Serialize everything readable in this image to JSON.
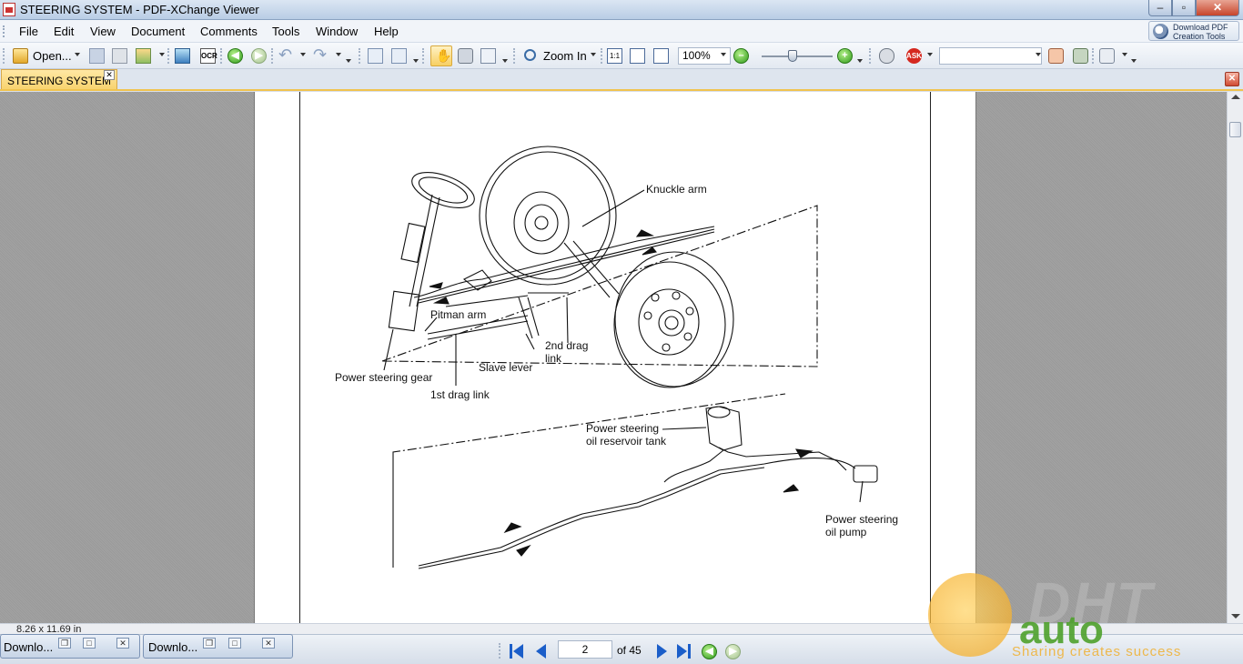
{
  "window": {
    "title": "STEERING SYSTEM - PDF-XChange Viewer",
    "buttons": {
      "minimize": "–",
      "maximize": "▫",
      "close": "✕"
    }
  },
  "menu": {
    "items": [
      "File",
      "Edit",
      "View",
      "Document",
      "Comments",
      "Tools",
      "Window",
      "Help"
    ],
    "download_pdf": {
      "line1": "Download PDF",
      "line2": "Creation Tools"
    }
  },
  "toolbar": {
    "open_label": "Open...",
    "zoom_in_label": "Zoom In",
    "zoom_value": "100%",
    "search_value": ""
  },
  "tab": {
    "label": "STEERING SYSTEM",
    "close": "✕"
  },
  "diagram": {
    "labels": {
      "knuckle_arm": "Knuckle arm",
      "pitman_arm": "Pitman arm",
      "second_drag_link_1": "2nd drag",
      "second_drag_link_2": "link",
      "slave_lever": "Slave lever",
      "power_steering_gear": "Power steering gear",
      "first_drag_link": "1st drag link",
      "reservoir_1": "Power steering",
      "reservoir_2": "oil reservoir tank",
      "pump_1": "Power steering",
      "pump_2": "oil pump"
    }
  },
  "status": {
    "page_size": "8.26 x 11.69 in"
  },
  "bottom": {
    "mini_windows": [
      {
        "label": "Downlo..."
      },
      {
        "label": "Downlo..."
      }
    ],
    "page_number": "2",
    "page_of": "of 45"
  },
  "watermark": {
    "brand": "DHT",
    "auto": "auto",
    "slogan": "Sharing creates success"
  },
  "colors": {
    "tab_accent": "#f8d36e",
    "nav_blue": "#1b5ec9",
    "nav_green": "#2f9a1a"
  }
}
